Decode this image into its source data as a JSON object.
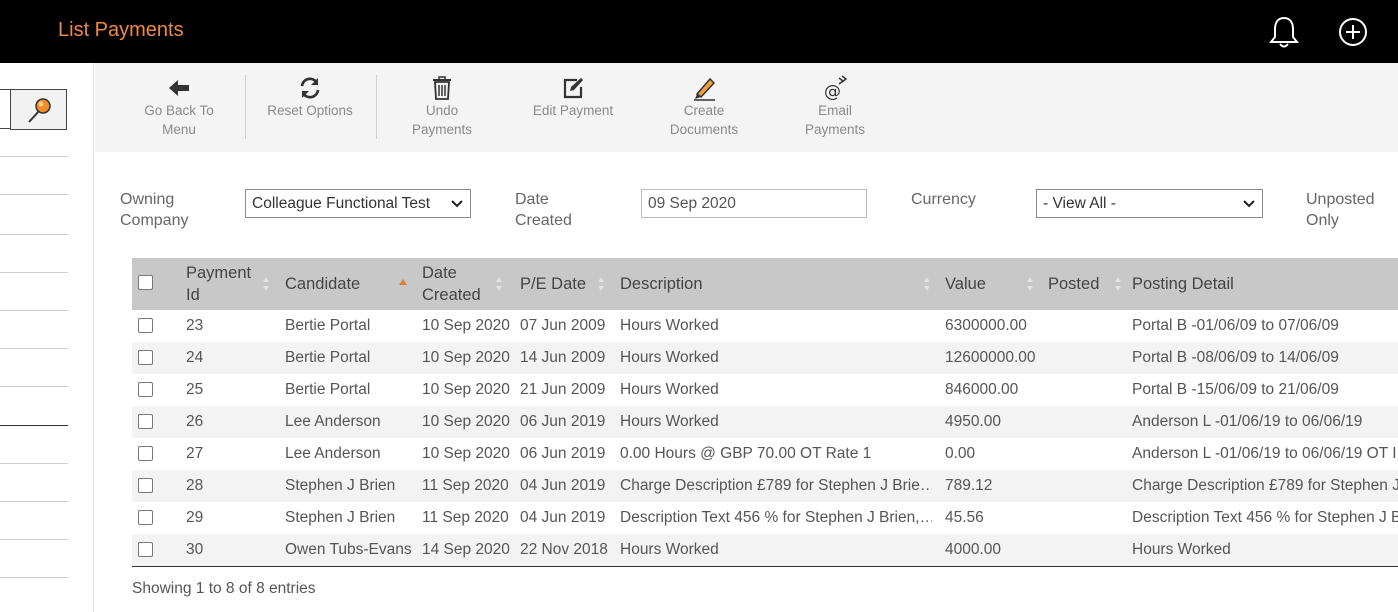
{
  "header": {
    "title": "List Payments",
    "accent": "#ee8a45"
  },
  "toolbar": {
    "back_line1": "Go Back To",
    "back_line2": "Menu",
    "reset_line1": "Reset Options",
    "undo_line1": "Undo",
    "undo_line2": "Payments",
    "edit_line1": "Edit Payment",
    "create_line1": "Create",
    "create_line2": "Documents",
    "email_line1": "Email",
    "email_line2": "Payments"
  },
  "filters": {
    "owning_label_1": "Owning",
    "owning_label_2": "Company",
    "owning_value": "Colleague Functional Test",
    "date_label_1": "Date",
    "date_label_2": "Created",
    "date_value": "09 Sep 2020",
    "currency_label": "Currency",
    "currency_value": "- View All -",
    "unposted_label_1": "Unposted",
    "unposted_label_2": "Only"
  },
  "table": {
    "headers": {
      "payment_id_1": "Payment",
      "payment_id_2": "Id",
      "candidate": "Candidate",
      "date_created_1": "Date",
      "date_created_2": "Created",
      "pe_date": "P/E Date",
      "description": "Description",
      "value": "Value",
      "posted": "Posted",
      "posting_detail": "Posting Detail"
    },
    "rows": [
      {
        "id": "23",
        "candidate": "Bertie Portal",
        "created": "10 Sep 2020",
        "pe": "07 Jun 2009",
        "desc": "Hours Worked",
        "value": "6300000.00",
        "posted": "",
        "detail": "Portal B -01/06/09 to 07/06/09"
      },
      {
        "id": "24",
        "candidate": "Bertie Portal",
        "created": "10 Sep 2020",
        "pe": "14 Jun 2009",
        "desc": "Hours Worked",
        "value": "12600000.00",
        "posted": "",
        "detail": "Portal B -08/06/09 to 14/06/09"
      },
      {
        "id": "25",
        "candidate": "Bertie Portal",
        "created": "10 Sep 2020",
        "pe": "21 Jun 2009",
        "desc": "Hours Worked",
        "value": "846000.00",
        "posted": "",
        "detail": "Portal B -15/06/09 to 21/06/09"
      },
      {
        "id": "26",
        "candidate": "Lee Anderson",
        "created": "10 Sep 2020",
        "pe": "06 Jun 2019",
        "desc": "Hours Worked",
        "value": "4950.00",
        "posted": "",
        "detail": "Anderson L -01/06/19 to 06/06/19"
      },
      {
        "id": "27",
        "candidate": "Lee Anderson",
        "created": "10 Sep 2020",
        "pe": "06 Jun 2019",
        "desc": "0.00 Hours @ GBP 70.00 OT Rate 1",
        "value": "0.00",
        "posted": "",
        "detail": "Anderson L -01/06/19 to 06/06/19 OT I"
      },
      {
        "id": "28",
        "candidate": "Stephen J Brien",
        "created": "11 Sep 2020",
        "pe": "04 Jun 2019",
        "desc": "Charge Description £789 for Stephen J Brie…",
        "value": "789.12",
        "posted": "",
        "detail": "Charge Description £789 for Stephen J"
      },
      {
        "id": "29",
        "candidate": "Stephen J Brien",
        "created": "11 Sep 2020",
        "pe": "04 Jun 2019",
        "desc": "Description Text 456 % for Stephen J Brien,…",
        "value": "45.56",
        "posted": "",
        "detail": "Description Text 456 % for Stephen J B"
      },
      {
        "id": "30",
        "candidate": "Owen Tubs-Evans",
        "created": "14 Sep 2020",
        "pe": "22 Nov 2018",
        "desc": "Hours Worked",
        "value": "4000.00",
        "posted": "",
        "detail": "Hours Worked"
      }
    ]
  },
  "footer": {
    "info": "Showing 1 to 8 of 8 entries"
  }
}
